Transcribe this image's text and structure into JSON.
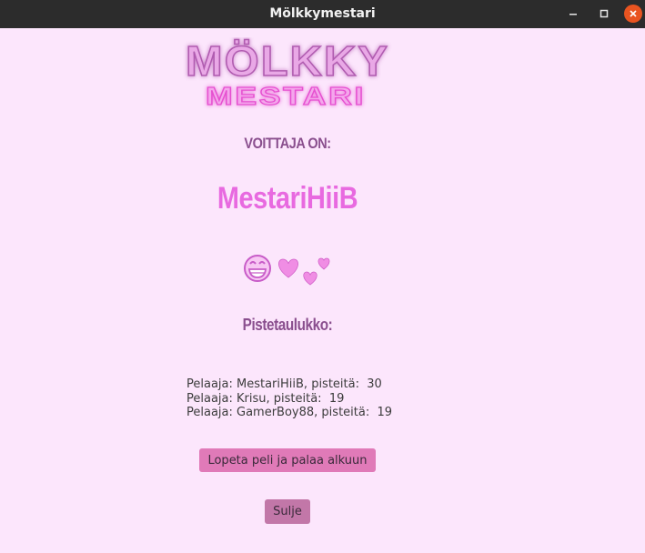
{
  "window": {
    "title": "Mölkkymestari",
    "controls": [
      "minimize-icon",
      "maximize-icon",
      "close-icon"
    ]
  },
  "logo": {
    "line1": "MÖLKKY",
    "line2": "MESTARI",
    "colors": {
      "line1": "#d98ad6",
      "line2": "#f06ad8",
      "glow": "#ff8af0"
    }
  },
  "result": {
    "heading": "VOITTAJA ON:",
    "winner": "MestariHiiB",
    "emojis": [
      "grinning-face-icon",
      "heart-icon",
      "two-hearts-icon"
    ]
  },
  "scoreboard": {
    "heading": "Pistetaulukko:",
    "rows": [
      "Pelaaja: MestariHiiB, pisteitä:  30",
      "Pelaaja: Krisu, pisteitä:  19",
      "Pelaaja: GamerBoy88, pisteitä:  19"
    ]
  },
  "buttons": {
    "restart_label": "Lopeta peli ja palaa alkuun",
    "close_label": "Sulje"
  },
  "colors": {
    "background": "#fce6fc",
    "heading": "#8a4f8e",
    "winner": "#e86ae0",
    "restart_button": "#e07ab8",
    "close_button": "#c277a8"
  }
}
